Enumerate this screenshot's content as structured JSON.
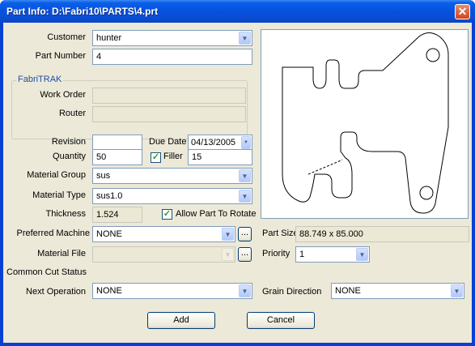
{
  "window": {
    "title": "Part Info: D:\\Fabri10\\PARTS\\4.prt",
    "close_glyph": "✕"
  },
  "labels": {
    "customer": "Customer",
    "part_number": "Part Number",
    "fabritrak": "FabriTRAK",
    "work_order": "Work Order",
    "router": "Router",
    "revision": "Revision",
    "due_date": "Due Date",
    "quantity": "Quantity",
    "filler": "Filler",
    "material_group": "Material Group",
    "material_type": "Material Type",
    "thickness": "Thickness",
    "allow_rotate": "Allow Part To Rotate",
    "preferred_machine": "Preferred Machine",
    "part_size": "Part Size",
    "material_file": "Material File",
    "priority": "Priority",
    "common_cut_status": "Common Cut Status",
    "next_operation": "Next Operation",
    "grain_direction": "Grain Direction"
  },
  "values": {
    "customer": "hunter",
    "part_number": "4",
    "work_order": "",
    "router": "",
    "revision": "",
    "due_date": "04/13/2005",
    "quantity": "50",
    "filler_checked": true,
    "filler": "15",
    "material_group": "sus",
    "material_type": "sus1.0",
    "thickness": "1.524",
    "allow_rotate_checked": true,
    "preferred_machine": "NONE",
    "part_size": "88.749 x 85.000",
    "material_file": "",
    "priority": "1",
    "next_operation": "NONE",
    "grain_direction": "NONE"
  },
  "buttons": {
    "add": "Add",
    "cancel": "Cancel",
    "browse": "..."
  },
  "glyphs": {
    "dropdown": "▼",
    "check": "✓"
  }
}
